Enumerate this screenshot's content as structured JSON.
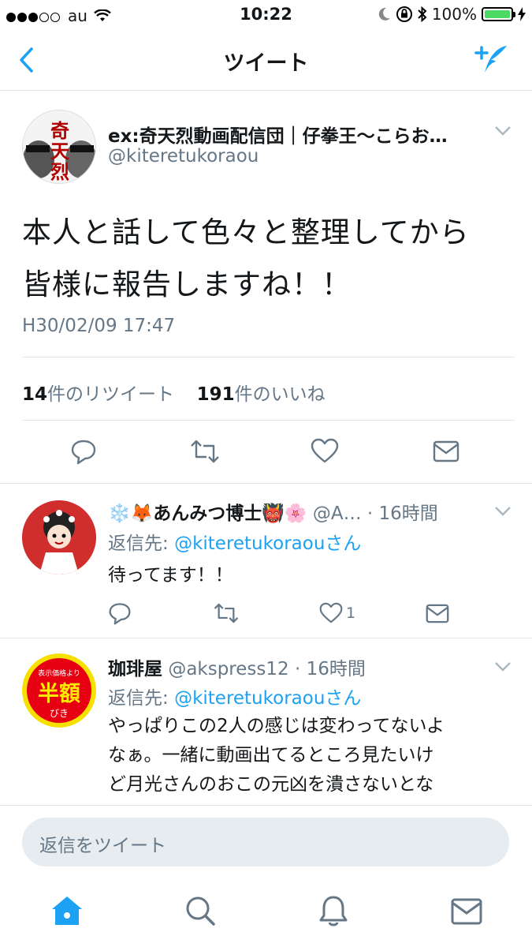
{
  "status_bar": {
    "carrier": "au",
    "time": "10:22",
    "battery": "100%"
  },
  "navbar": {
    "title": "ツイート"
  },
  "main_tweet": {
    "display_name": "ex:奇天烈動画配信団｜仔拳王〜こらお…",
    "handle": "@kiteretukoraou",
    "text_line1": "本人と話して色々と整理してから",
    "text_line2": "皆様に報告しますね！！",
    "timestamp": "H30/02/09 17:47",
    "retweet_count": "14",
    "retweet_label": "件のリツイート",
    "like_count": "191",
    "like_label": "件のいいね"
  },
  "replies": [
    {
      "display_name": "❄️🦊あんみつ博士👹🌸",
      "handle": "@A…",
      "time": "· 16時間",
      "reply_to_prefix": "返信先: ",
      "reply_to_handle": "@kiteretukoraou",
      "reply_to_suffix": "さん",
      "text": "待ってます！！",
      "like_count": "1"
    },
    {
      "display_name": "珈琲屋",
      "handle": "@akspress12",
      "time": "· 16時間",
      "reply_to_prefix": "返信先: ",
      "reply_to_handle": "@kiteretukoraou",
      "reply_to_suffix": "さん",
      "text_line1": "やっぱりこの2人の感じは変わってないよ",
      "text_line2": "なぁ。一緒に動画出てるところ見たいけ",
      "text_line3": "ど月光さんのおこの元凶を潰さないとな",
      "avatar_text_top": "表示価格より",
      "avatar_text_main": "半額",
      "avatar_text_bottom": "びき"
    }
  ],
  "reply_box": {
    "placeholder": "返信をツイート"
  },
  "colors": {
    "accent": "#1da1f2",
    "secondary_text": "#657786",
    "divider": "#e1e8ed"
  },
  "icons": [
    "back-chevron-icon",
    "compose-tweet-icon",
    "reply-icon",
    "retweet-icon",
    "like-icon",
    "dm-icon",
    "home-icon",
    "search-icon",
    "notifications-icon",
    "messages-icon"
  ]
}
